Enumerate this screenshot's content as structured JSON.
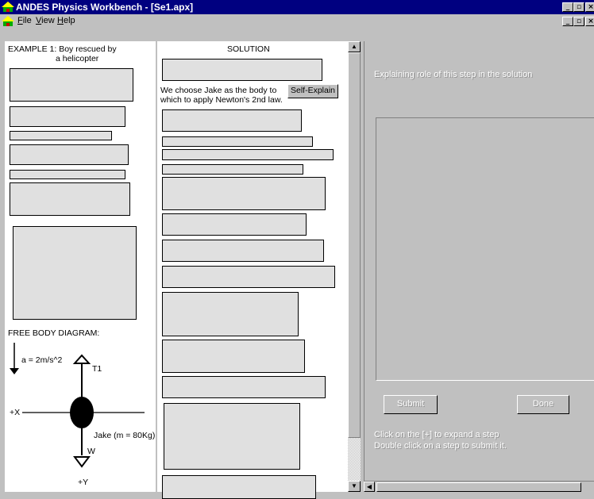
{
  "window": {
    "title": "ANDES Physics Workbench - [Se1.apx]",
    "controls": [
      "_",
      "▫",
      "×"
    ],
    "mdi_controls": [
      "_",
      "▫",
      "×"
    ]
  },
  "menu": [
    {
      "label": "File",
      "underline": "F",
      "rest": "ile"
    },
    {
      "label": "View",
      "underline": "V",
      "rest": "iew"
    },
    {
      "label": "Help",
      "underline": "H",
      "rest": "elp"
    }
  ],
  "example": {
    "title_line1": "EXAMPLE 1: Boy rescued by",
    "title_line2": "a helicopter"
  },
  "fbd": {
    "heading": "FREE BODY DIAGRAM:",
    "accel": "a = 2m/s^2",
    "t1": "T1",
    "plus_x": "+X",
    "body": "Jake (m = 80Kg)",
    "w": "W",
    "plus_y": "+Y"
  },
  "solution": {
    "heading": "SOLUTION",
    "step_line1": "We choose Jake as the body to",
    "step_line2": "which to apply Newton's 2nd law.",
    "self_explain": "Self-Explain"
  },
  "explain_panel": {
    "prompt": "Explaining role of this step in the solution",
    "submit": "Submit",
    "done": "Done",
    "help_line1": "Click on the [+] to expand a step",
    "help_line2": "Double click on a step to submit it."
  },
  "colors": {
    "titlebar": "#000080",
    "box": "#e0e0e0",
    "face": "#c0c0c0"
  }
}
